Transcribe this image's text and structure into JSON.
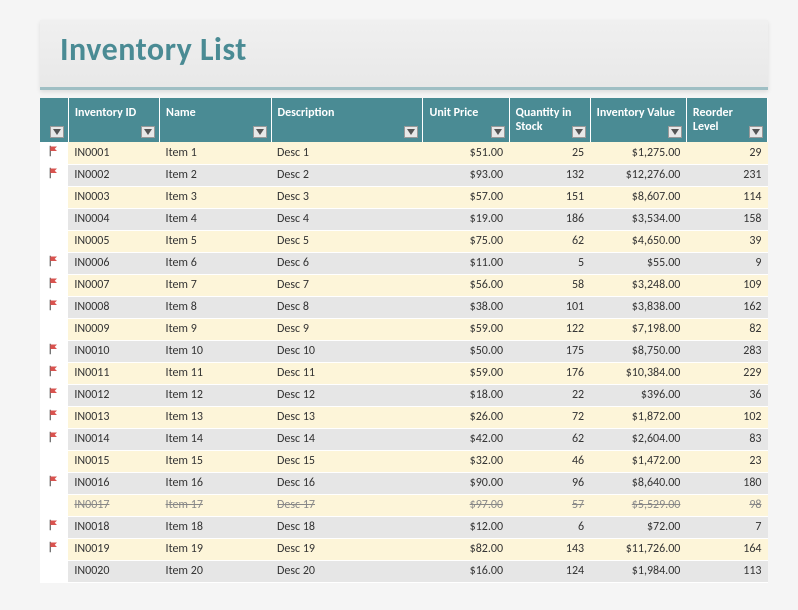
{
  "title": "Inventory List",
  "headers": {
    "flag": "",
    "id": "Inventory ID",
    "name": "Name",
    "desc": "Description",
    "price": "Unit Price",
    "qty": "Quantity in Stock",
    "value": "Inventory Value",
    "reorder": "Reorder Level"
  },
  "rows": [
    {
      "flag": true,
      "id": "IN0001",
      "name": "Item 1",
      "desc": "Desc 1",
      "price": "$51.00",
      "qty": "25",
      "value": "$1,275.00",
      "reorder": "29",
      "strike": false
    },
    {
      "flag": true,
      "id": "IN0002",
      "name": "Item 2",
      "desc": "Desc 2",
      "price": "$93.00",
      "qty": "132",
      "value": "$12,276.00",
      "reorder": "231",
      "strike": false
    },
    {
      "flag": false,
      "id": "IN0003",
      "name": "Item 3",
      "desc": "Desc 3",
      "price": "$57.00",
      "qty": "151",
      "value": "$8,607.00",
      "reorder": "114",
      "strike": false
    },
    {
      "flag": false,
      "id": "IN0004",
      "name": "Item 4",
      "desc": "Desc 4",
      "price": "$19.00",
      "qty": "186",
      "value": "$3,534.00",
      "reorder": "158",
      "strike": false
    },
    {
      "flag": false,
      "id": "IN0005",
      "name": "Item 5",
      "desc": "Desc 5",
      "price": "$75.00",
      "qty": "62",
      "value": "$4,650.00",
      "reorder": "39",
      "strike": false
    },
    {
      "flag": true,
      "id": "IN0006",
      "name": "Item 6",
      "desc": "Desc 6",
      "price": "$11.00",
      "qty": "5",
      "value": "$55.00",
      "reorder": "9",
      "strike": false
    },
    {
      "flag": true,
      "id": "IN0007",
      "name": "Item 7",
      "desc": "Desc 7",
      "price": "$56.00",
      "qty": "58",
      "value": "$3,248.00",
      "reorder": "109",
      "strike": false
    },
    {
      "flag": true,
      "id": "IN0008",
      "name": "Item 8",
      "desc": "Desc 8",
      "price": "$38.00",
      "qty": "101",
      "value": "$3,838.00",
      "reorder": "162",
      "strike": false
    },
    {
      "flag": false,
      "id": "IN0009",
      "name": "Item 9",
      "desc": "Desc 9",
      "price": "$59.00",
      "qty": "122",
      "value": "$7,198.00",
      "reorder": "82",
      "strike": false
    },
    {
      "flag": true,
      "id": "IN0010",
      "name": "Item 10",
      "desc": "Desc 10",
      "price": "$50.00",
      "qty": "175",
      "value": "$8,750.00",
      "reorder": "283",
      "strike": false
    },
    {
      "flag": true,
      "id": "IN0011",
      "name": "Item 11",
      "desc": "Desc 11",
      "price": "$59.00",
      "qty": "176",
      "value": "$10,384.00",
      "reorder": "229",
      "strike": false
    },
    {
      "flag": true,
      "id": "IN0012",
      "name": "Item 12",
      "desc": "Desc 12",
      "price": "$18.00",
      "qty": "22",
      "value": "$396.00",
      "reorder": "36",
      "strike": false
    },
    {
      "flag": true,
      "id": "IN0013",
      "name": "Item 13",
      "desc": "Desc 13",
      "price": "$26.00",
      "qty": "72",
      "value": "$1,872.00",
      "reorder": "102",
      "strike": false
    },
    {
      "flag": true,
      "id": "IN0014",
      "name": "Item 14",
      "desc": "Desc 14",
      "price": "$42.00",
      "qty": "62",
      "value": "$2,604.00",
      "reorder": "83",
      "strike": false
    },
    {
      "flag": false,
      "id": "IN0015",
      "name": "Item 15",
      "desc": "Desc 15",
      "price": "$32.00",
      "qty": "46",
      "value": "$1,472.00",
      "reorder": "23",
      "strike": false
    },
    {
      "flag": true,
      "id": "IN0016",
      "name": "Item 16",
      "desc": "Desc 16",
      "price": "$90.00",
      "qty": "96",
      "value": "$8,640.00",
      "reorder": "180",
      "strike": false
    },
    {
      "flag": false,
      "id": "IN0017",
      "name": "Item 17",
      "desc": "Desc 17",
      "price": "$97.00",
      "qty": "57",
      "value": "$5,529.00",
      "reorder": "98",
      "strike": true
    },
    {
      "flag": true,
      "id": "IN0018",
      "name": "Item 18",
      "desc": "Desc 18",
      "price": "$12.00",
      "qty": "6",
      "value": "$72.00",
      "reorder": "7",
      "strike": false
    },
    {
      "flag": true,
      "id": "IN0019",
      "name": "Item 19",
      "desc": "Desc 19",
      "price": "$82.00",
      "qty": "143",
      "value": "$11,726.00",
      "reorder": "164",
      "strike": false
    },
    {
      "flag": false,
      "id": "IN0020",
      "name": "Item 20",
      "desc": "Desc 20",
      "price": "$16.00",
      "qty": "124",
      "value": "$1,984.00",
      "reorder": "113",
      "strike": false
    }
  ]
}
